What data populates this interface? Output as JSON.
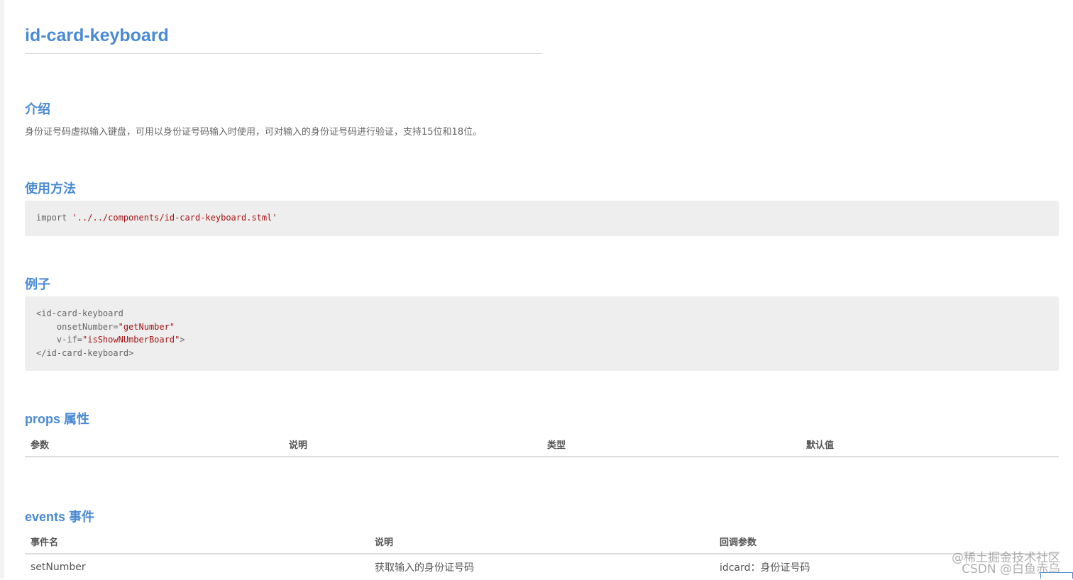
{
  "page": {
    "title": "id-card-keyboard"
  },
  "intro": {
    "heading": "介绍",
    "text": "身份证号码虚拟输入键盘，可用以身份证号码输入时使用，可对输入的身份证号码进行验证，支持15位和18位。"
  },
  "usage": {
    "heading": "使用方法",
    "code": {
      "keyword": "import ",
      "path": "'../../components/id-card-keyboard.stml'"
    }
  },
  "example": {
    "heading": "例子",
    "lines": {
      "l1": "<id-card-keyboard",
      "l2_attr": "    onsetNumber=",
      "l2_val": "\"getNumber\"",
      "l3_attr": "    v-if=",
      "l3_val": "\"isShowNUmberBoard\"",
      "l3_end": ">",
      "l4": "</id-card-keyboard>"
    }
  },
  "props": {
    "heading": "props 属性",
    "columns": [
      "参数",
      "说明",
      "类型",
      "默认值"
    ]
  },
  "events": {
    "heading": "events 事件",
    "columns": [
      "事件名",
      "说明",
      "回调参数"
    ],
    "rows": [
      [
        "setNumber",
        "获取输入的身份证号码",
        "idcard：身份证号码"
      ]
    ]
  },
  "watermark": {
    "line1": "@稀土掘金技术社区",
    "line2": "CSDN @白鱼赤乌"
  }
}
